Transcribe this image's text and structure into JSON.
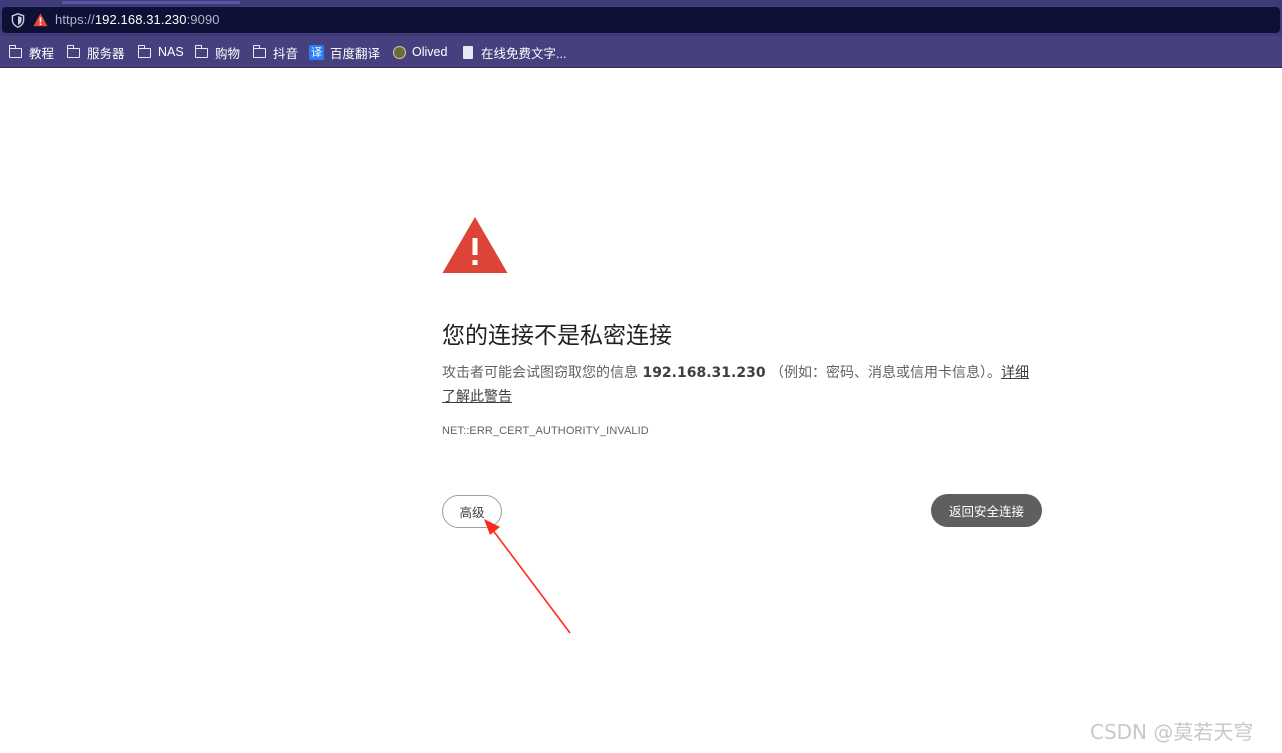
{
  "browser": {
    "address_bar": {
      "url_scheme": "https://",
      "url_host": "192.168.31.230",
      "url_port": ":9090"
    },
    "bookmarks": [
      {
        "label": "教程",
        "icon": "folder-icon"
      },
      {
        "label": "服务器",
        "icon": "folder-icon"
      },
      {
        "label": "NAS",
        "icon": "folder-icon"
      },
      {
        "label": "购物",
        "icon": "folder-icon"
      },
      {
        "label": "抖音",
        "icon": "folder-icon"
      },
      {
        "label": "百度翻译",
        "icon": "baidu-translate-icon",
        "icon_text": "译"
      },
      {
        "label": "Olived",
        "icon": "olived-icon"
      },
      {
        "label": "在线免费文字...",
        "icon": "page-icon"
      }
    ]
  },
  "interstitial": {
    "title": "您的连接不是私密连接",
    "desc_prefix": "攻击者可能会试图窃取您的信息 ",
    "desc_host": "192.168.31.230",
    "desc_suffix": " （例如：密码、消息或信用卡信息）。",
    "learn_more": "详细了解此警告",
    "error_code": "NET::ERR_CERT_AUTHORITY_INVALID",
    "advanced_button": "高级",
    "back_button": "返回安全连接"
  },
  "watermark": "CSDN @莫若天穹",
  "colors": {
    "warning_red": "#db4437",
    "annotation_arrow": "#ff2a1a",
    "back_button_bg": "#5f5f5f",
    "toolbar_bg": "#46407f"
  }
}
